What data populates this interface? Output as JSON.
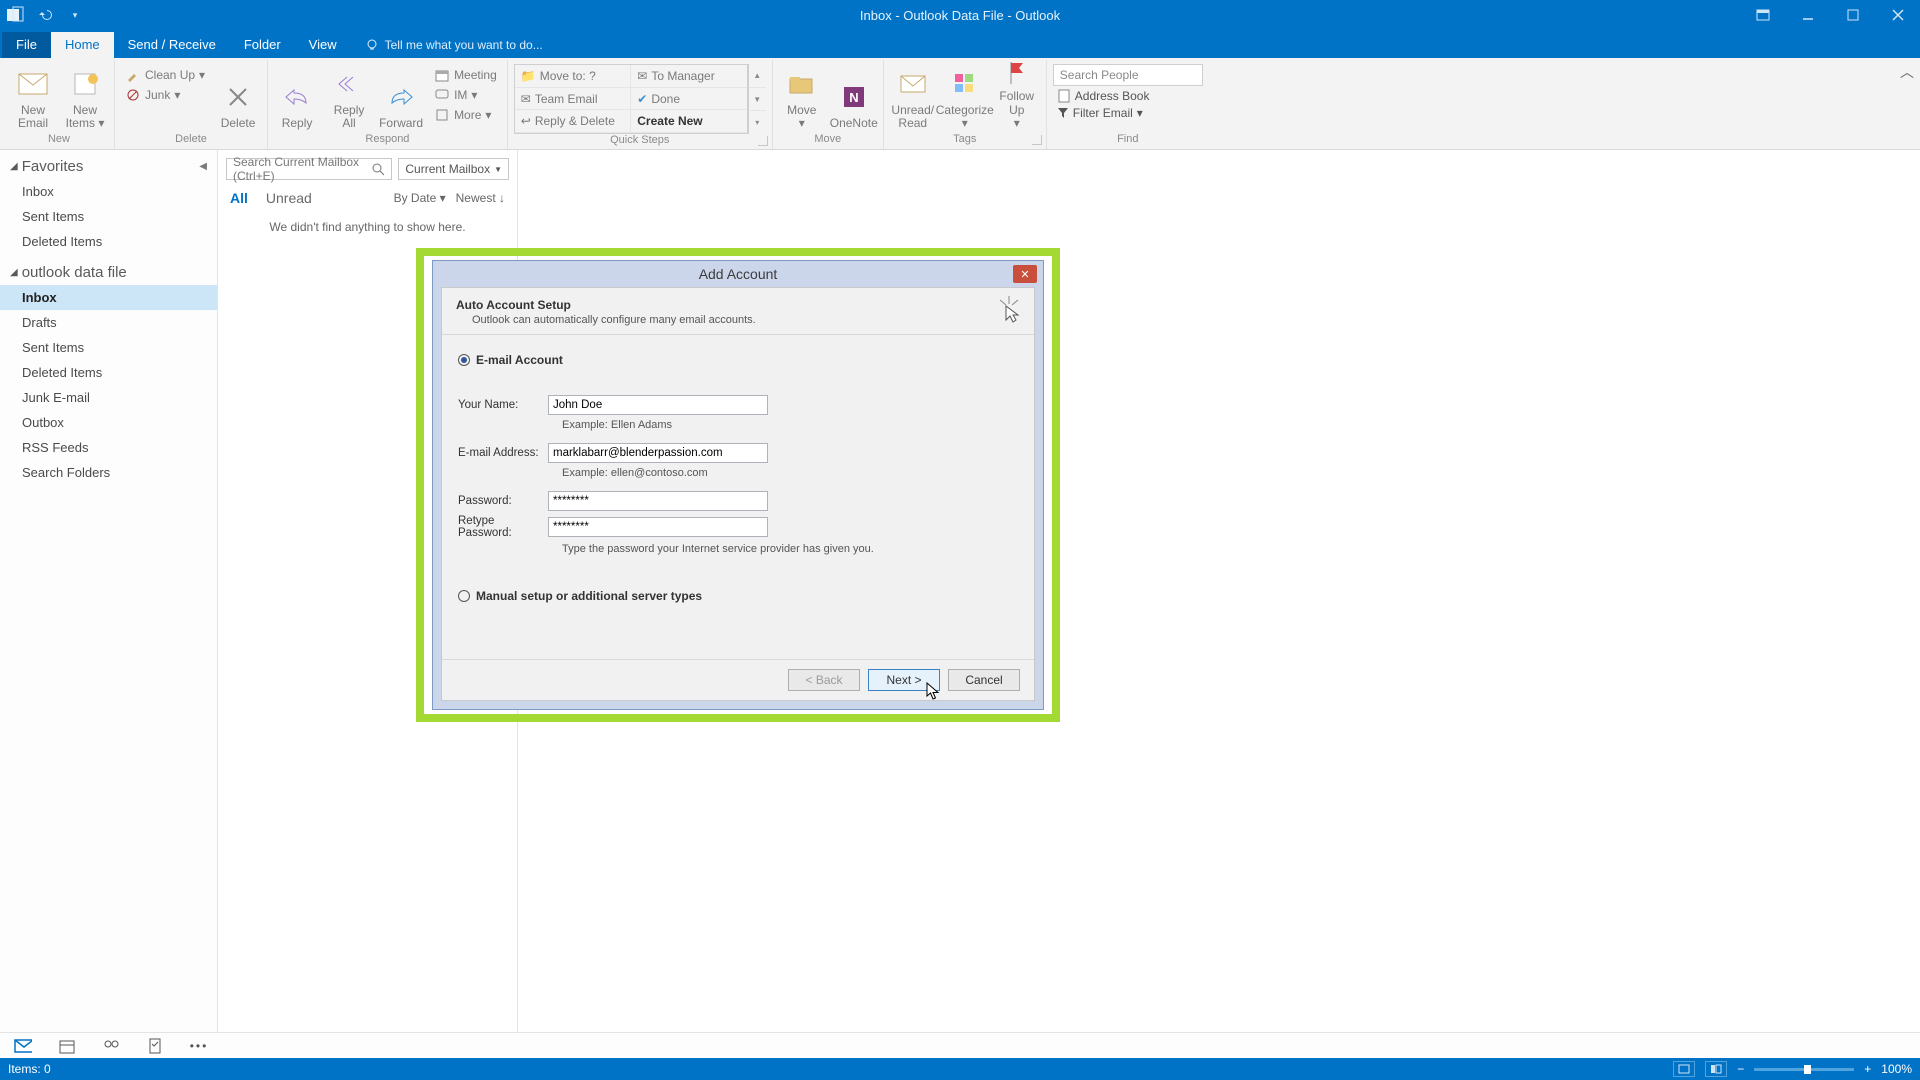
{
  "titlebar": {
    "title": "Inbox - Outlook Data File - Outlook"
  },
  "tabs": {
    "file": "File",
    "home": "Home",
    "sendreceive": "Send / Receive",
    "folder": "Folder",
    "view": "View",
    "tell": "Tell me what you want to do..."
  },
  "ribbon": {
    "new_email": "New\nEmail",
    "new_items": "New\nItems",
    "new_group": "New",
    "cleanup": "Clean Up",
    "junk": "Junk",
    "delete": "Delete",
    "delete_group": "Delete",
    "reply": "Reply",
    "replyall": "Reply\nAll",
    "forward": "Forward",
    "meeting": "Meeting",
    "im": "IM",
    "more": "More",
    "respond_group": "Respond",
    "qs_moveto": "Move to: ?",
    "qs_manager": "To Manager",
    "qs_team": "Team Email",
    "qs_done": "Done",
    "qs_replydel": "Reply & Delete",
    "qs_new": "Create New",
    "qs_group": "Quick Steps",
    "move": "Move",
    "onenote": "OneNote",
    "move_group": "Move",
    "unread": "Unread/\nRead",
    "categorize": "Categorize",
    "followup": "Follow\nUp",
    "tags_group": "Tags",
    "searchpeople_ph": "Search People",
    "addressbook": "Address Book",
    "filteremail": "Filter Email",
    "find_group": "Find"
  },
  "nav": {
    "favorites": "Favorites",
    "fav_inbox": "Inbox",
    "fav_sent": "Sent Items",
    "fav_deleted": "Deleted Items",
    "datafile": "outlook data file",
    "inbox": "Inbox",
    "drafts": "Drafts",
    "sent": "Sent Items",
    "deleted": "Deleted Items",
    "junk": "Junk E-mail",
    "outbox": "Outbox",
    "rss": "RSS Feeds",
    "searchfolders": "Search Folders"
  },
  "list": {
    "search_ph": "Search Current Mailbox (Ctrl+E)",
    "scope": "Current Mailbox",
    "all": "All",
    "unread": "Unread",
    "bydate": "By Date",
    "newest": "Newest",
    "empty": "We didn't find anything to show here."
  },
  "status": {
    "items": "Items: 0",
    "zoom": "100%"
  },
  "dialog": {
    "title": "Add Account",
    "hdr_title": "Auto Account Setup",
    "hdr_sub": "Outlook can automatically configure many email accounts.",
    "opt_email": "E-mail Account",
    "lbl_name": "Your Name:",
    "val_name": "John Doe",
    "ex_name": "Example: Ellen Adams",
    "lbl_email": "E-mail Address:",
    "val_email": "marklabarr@blenderpassion.com",
    "ex_email": "Example: ellen@contoso.com",
    "lbl_pw": "Password:",
    "val_pw": "********",
    "lbl_pw2": "Retype Password:",
    "val_pw2": "********",
    "pw_hint": "Type the password your Internet service provider has given you.",
    "opt_manual": "Manual setup or additional server types",
    "btn_back": "< Back",
    "btn_next": "Next >",
    "btn_cancel": "Cancel"
  }
}
